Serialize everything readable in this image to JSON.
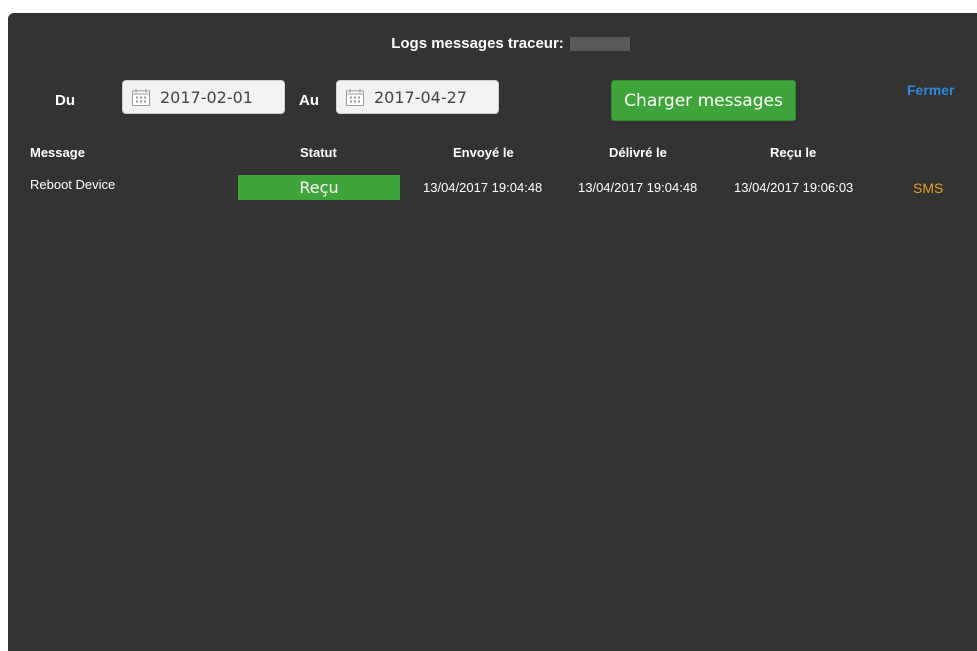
{
  "dialog": {
    "title": "Logs messages traceur:",
    "close_label": "Fermer"
  },
  "filter": {
    "from_label": "Du",
    "from_value": "2017-02-01",
    "to_label": "Au",
    "to_value": "2017-04-27",
    "load_button": "Charger messages"
  },
  "table": {
    "headers": {
      "message": "Message",
      "status": "Statut",
      "sent": "Envoyé le",
      "delivered": "Délivré le",
      "received": "Reçu le"
    },
    "rows": [
      {
        "message": "Reboot Device",
        "status": "Reçu",
        "sent": "13/04/2017 19:04:48",
        "delivered": "13/04/2017 19:04:48",
        "received": "13/04/2017 19:06:03",
        "channel": "SMS"
      }
    ]
  },
  "colors": {
    "panel_bg": "#333333",
    "accent_green": "#3fa43a",
    "link_blue": "#2f88d8",
    "channel_orange": "#e6a021"
  },
  "icons": {
    "date_picker": "calendar-icon"
  }
}
